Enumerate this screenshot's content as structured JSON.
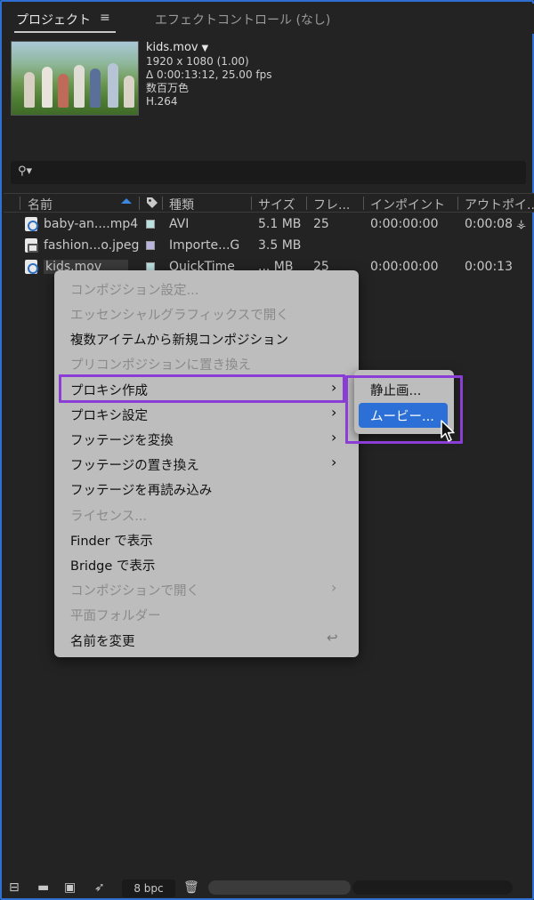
{
  "tabs": {
    "project": "プロジェクト",
    "menu_icon": "≡",
    "effect": "エフェクトコントロール (なし)"
  },
  "preview": {
    "name": "kids.mov",
    "resolution": "1920 x 1080 (1.00)",
    "duration": "Δ 0:00:13:12, 25.00 fps",
    "colors": "数百万色",
    "codec": "H.264"
  },
  "table": {
    "headers": {
      "name": "名前",
      "type": "種類",
      "size": "サイズ",
      "frame": "フレ...",
      "in": "インポイント",
      "out": "アウトポイ..."
    },
    "rows": [
      {
        "name": "baby-an....mp4",
        "type": "AVI",
        "size": "5.1 MB",
        "frame": "25",
        "in": "0:00:00:00",
        "out": "0:00:08",
        "label_color": "#b9e0df"
      },
      {
        "name": "fashion...o.jpeg",
        "type": "Importe...G",
        "size": "3.5 MB",
        "frame": "",
        "in": "",
        "out": "",
        "label_color": "#b9b3e0"
      },
      {
        "name": "kids.mov",
        "type": "QuickTime",
        "size": "... MB",
        "frame": "25",
        "in": "0:00:00:00",
        "out": "0:00:13",
        "label_color": "#b9e0df"
      }
    ]
  },
  "context_menu": {
    "items": [
      {
        "label": "コンポジション設定...",
        "enabled": false,
        "submenu": false
      },
      {
        "label": "エッセンシャルグラフィックスで開く",
        "enabled": false,
        "submenu": false
      },
      {
        "label": "複数アイテムから新規コンポジション",
        "enabled": true,
        "submenu": false
      },
      {
        "label": "プリコンポジションに置き換え",
        "enabled": false,
        "submenu": false
      },
      {
        "label": "プロキシ作成",
        "enabled": true,
        "submenu": true
      },
      {
        "label": "プロキシ設定",
        "enabled": true,
        "submenu": true
      },
      {
        "label": "フッテージを変換",
        "enabled": true,
        "submenu": true
      },
      {
        "label": "フッテージの置き換え",
        "enabled": true,
        "submenu": true
      },
      {
        "label": "フッテージを再読み込み",
        "enabled": true,
        "submenu": false
      },
      {
        "label": "ライセンス...",
        "enabled": false,
        "submenu": false
      },
      {
        "label": "Finder で表示",
        "enabled": true,
        "submenu": false
      },
      {
        "label": "Bridge で表示",
        "enabled": true,
        "submenu": false
      },
      {
        "label": "コンポジションで開く",
        "enabled": false,
        "submenu": true
      },
      {
        "label": "平面フォルダー",
        "enabled": false,
        "submenu": false
      },
      {
        "label": "名前を変更",
        "enabled": true,
        "submenu": false,
        "shortcut": "↩"
      }
    ]
  },
  "submenu": {
    "still": "静止画...",
    "movie": "ムービー..."
  },
  "toolbar": {
    "bpc": "8 bpc"
  },
  "colors": {
    "accent": "#2c6fd6",
    "highlight_box": "#8a3ed6",
    "panel": "#232323",
    "menu_bg": "#bdbdbd"
  }
}
